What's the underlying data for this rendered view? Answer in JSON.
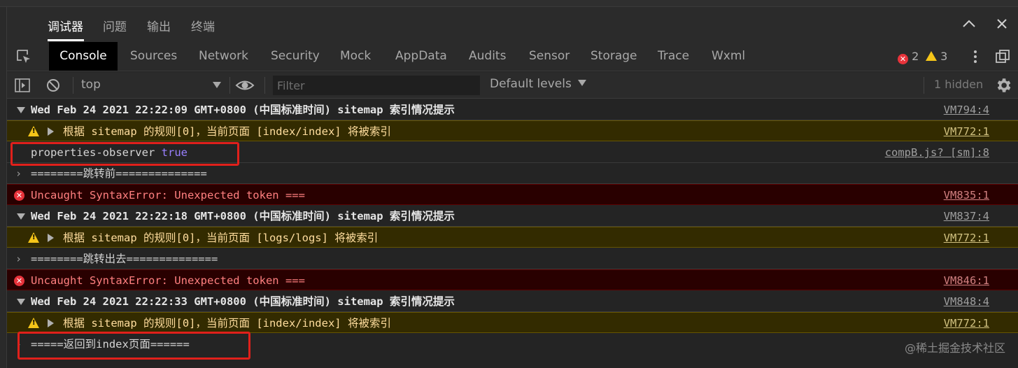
{
  "top_tabs": [
    "调试器",
    "问题",
    "输出",
    "终端"
  ],
  "panel_tabs": [
    "Console",
    "Sources",
    "Network",
    "Security",
    "Mock",
    "AppData",
    "Audits",
    "Sensor",
    "Storage",
    "Trace",
    "Wxml"
  ],
  "badges": {
    "errors": "2",
    "warnings": "3"
  },
  "toolbar": {
    "context": "top",
    "filter_placeholder": "Filter",
    "levels": "Default levels",
    "hidden": "1 hidden"
  },
  "console_rows": [
    {
      "kind": "group",
      "text": "Wed Feb 24 2021 22:22:09 GMT+0800 (中国标准时间) sitemap 索引情况提示",
      "source": "VM794:4"
    },
    {
      "kind": "warn",
      "text": "根据 sitemap 的规则[0]，当前页面 [index/index] 将被索引",
      "source": "VM772:1"
    },
    {
      "kind": "log",
      "text": "properties-observer",
      "value": "true",
      "source": "compB.js? [sm]:8"
    },
    {
      "kind": "log-chev",
      "text": "========跳转前==============",
      "source": ""
    },
    {
      "kind": "error",
      "text": "Uncaught SyntaxError: Unexpected token ===",
      "source": "VM835:1"
    },
    {
      "kind": "group",
      "text": "Wed Feb 24 2021 22:22:18 GMT+0800 (中国标准时间) sitemap 索引情况提示",
      "source": "VM837:4"
    },
    {
      "kind": "warn",
      "text": "根据 sitemap 的规则[0]，当前页面 [logs/logs] 将被索引",
      "source": "VM772:1"
    },
    {
      "kind": "log-chev",
      "text": "========跳转出去==============",
      "source": ""
    },
    {
      "kind": "error",
      "text": "Uncaught SyntaxError: Unexpected token ===",
      "source": "VM846:1"
    },
    {
      "kind": "group",
      "text": "Wed Feb 24 2021 22:22:33 GMT+0800 (中国标准时间) sitemap 索引情况提示",
      "source": "VM848:4"
    },
    {
      "kind": "warn",
      "text": "根据 sitemap 的规则[0]，当前页面 [index/index] 将被索引",
      "source": "VM772:1"
    },
    {
      "kind": "log-chev",
      "text": "=====返回到index页面======",
      "source": ""
    }
  ],
  "watermark": "@稀土掘金技术社区",
  "colors": {
    "highlight": "#e0201b",
    "error": "#e8333b",
    "warning": "#f5c518",
    "true_keyword": "#9980ff"
  }
}
